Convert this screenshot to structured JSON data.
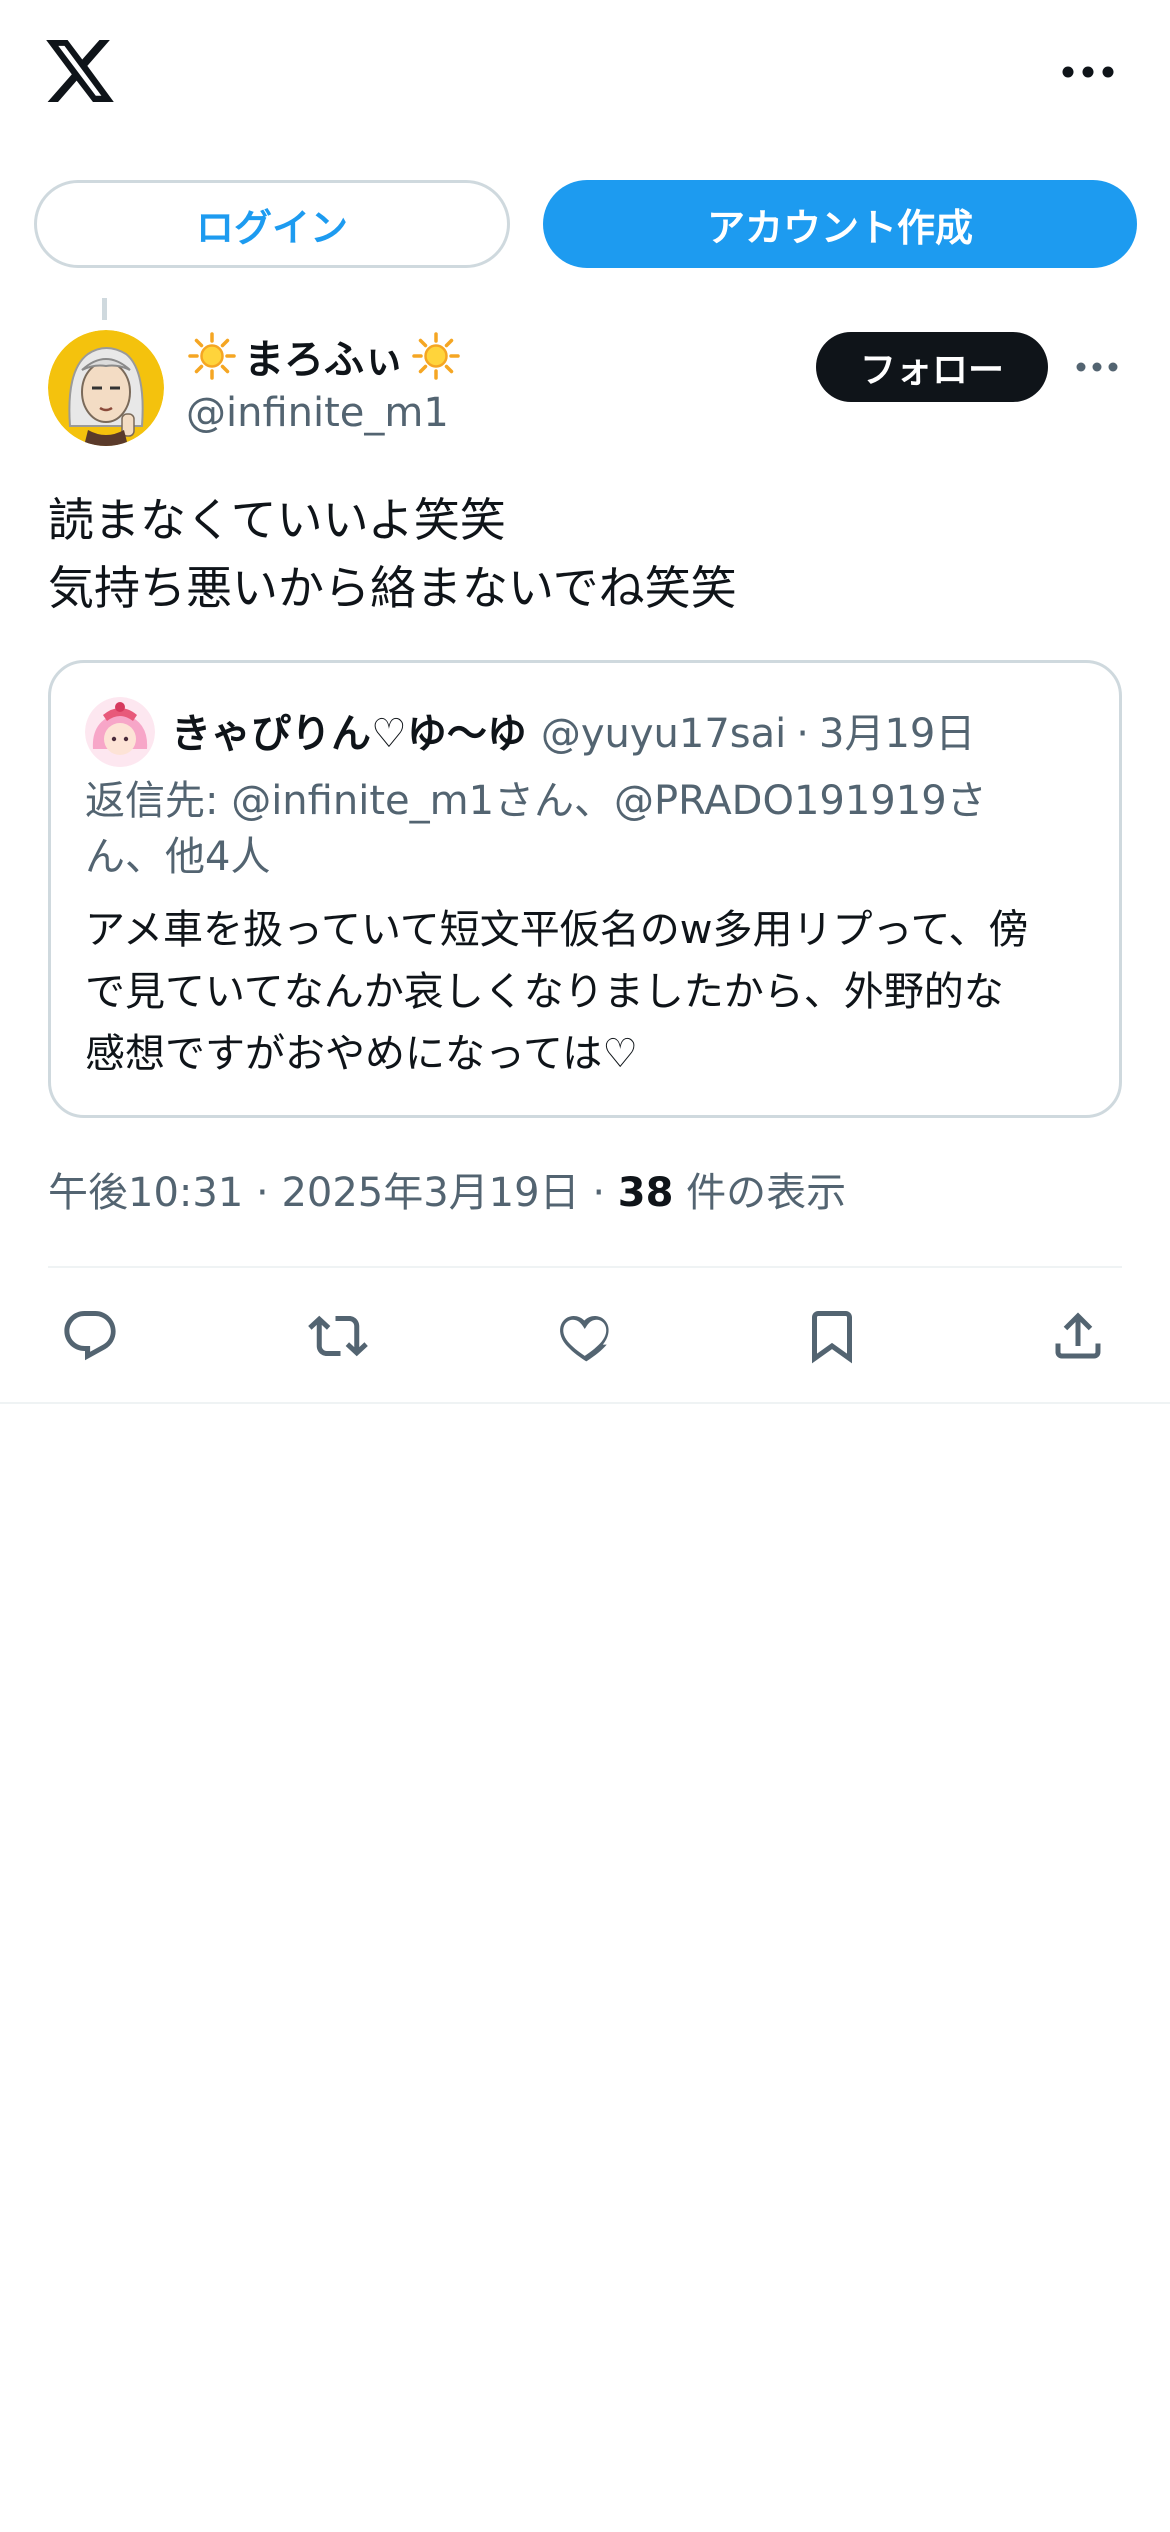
{
  "header": {
    "logo_icon": "x-logo-icon",
    "more_icon": "more-horizontal-icon"
  },
  "auth": {
    "login_label": "ログイン",
    "signup_label": "アカウント作成",
    "accent": "#1d9bf0"
  },
  "tweet": {
    "display_name": "まろふぃ",
    "name_emoji_icon": "sun-icon",
    "handle": "@infinite_m1",
    "follow_label": "フォロー",
    "text_lines": [
      "読まなくていいよ笑笑",
      "気持ち悪いから絡まないでね笑笑"
    ],
    "time": "午後10:31",
    "sep1": "·",
    "date": "2025年3月19日",
    "sep2": "·",
    "views_count": "38",
    "views_label": "件の表示"
  },
  "quote": {
    "display_name": "きゃぴりん♡ゆ〜ゆ",
    "handle": "@yuyu17sai",
    "sep": "·",
    "date": "3月19日",
    "reply_lines": [
      "返信先: @infinite_m1さん、@PRADO191919さ",
      "ん、他4人"
    ],
    "text_lines": [
      "アメ車を扱っていて短文平仮名のw多用リプって、傍",
      "で見ていてなんか哀しくなりましたから、外野的な",
      "感想ですがおやめになっては♡"
    ]
  },
  "actions": [
    "reply-icon",
    "retweet-icon",
    "like-icon",
    "bookmark-icon",
    "share-icon"
  ]
}
